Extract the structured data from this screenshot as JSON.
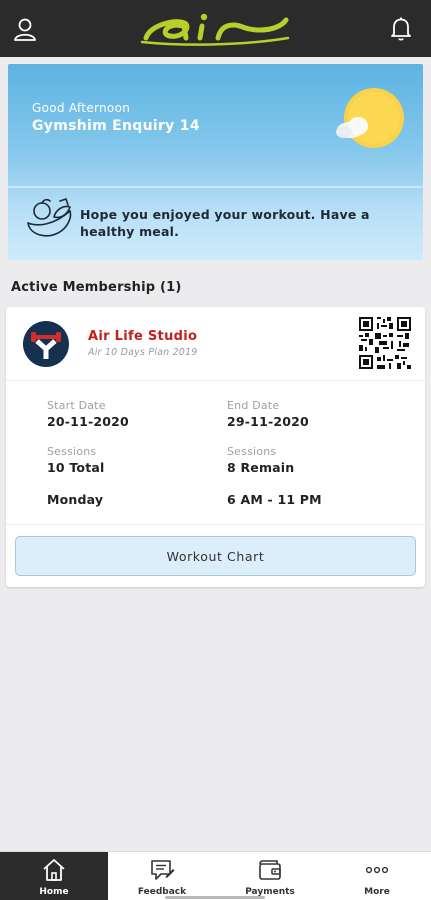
{
  "app": {
    "brand": "air"
  },
  "header": {
    "user_icon": "user-icon",
    "bell_icon": "bell-icon"
  },
  "hero": {
    "greeting": "Good Afternoon",
    "user_name": "Gymshim Enquiry 14",
    "weather_icon": "sun-cloud-icon",
    "meal_icon": "healthy-meal-icon",
    "message": "Hope you enjoyed your workout. Have a healthy meal."
  },
  "membership": {
    "section_title": "Active Membership (1)",
    "gym_name": "Air Life Studio",
    "plan_name": "Air 10 Days Plan 2019",
    "start_date_label": "Start Date",
    "start_date": "20-11-2020",
    "end_date_label": "End Date",
    "end_date": "29-11-2020",
    "sessions_label": "Sessions",
    "sessions_total": "10 Total",
    "sessions_remain_label": "Sessions",
    "sessions_remain": "8 Remain",
    "day": "Monday",
    "time": "6 AM - 11 PM",
    "workout_button": "Workout Chart"
  },
  "colors": {
    "accent_green": "#b8cf2a",
    "gym_red": "#c41e1e",
    "navy": "#16304f"
  },
  "tabs": [
    {
      "label": "Home",
      "icon": "home-icon",
      "active": true
    },
    {
      "label": "Feedback",
      "icon": "feedback-icon",
      "active": false
    },
    {
      "label": "Payments",
      "icon": "wallet-icon",
      "active": false
    },
    {
      "label": "More",
      "icon": "more-icon",
      "active": false
    }
  ]
}
